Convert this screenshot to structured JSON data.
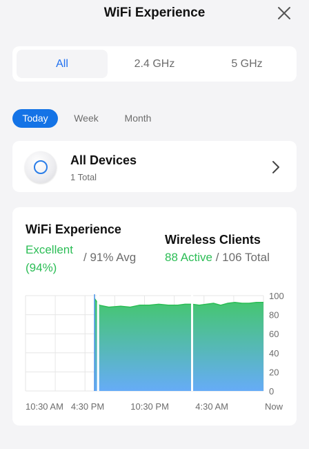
{
  "header": {
    "title": "WiFi Experience",
    "close_icon": "close-icon"
  },
  "bands": {
    "tabs": [
      {
        "label": "All",
        "active": true
      },
      {
        "label": "2.4 GHz",
        "active": false
      },
      {
        "label": "5 GHz",
        "active": false
      }
    ]
  },
  "range": {
    "tabs": [
      {
        "label": "Today",
        "active": true
      },
      {
        "label": "Week",
        "active": false
      },
      {
        "label": "Month",
        "active": false
      }
    ]
  },
  "device": {
    "title": "All Devices",
    "subtitle": "1 Total",
    "icon": "access-point-icon"
  },
  "summary": {
    "experience_title": "WiFi Experience",
    "experience_value": "Excellent (94%)",
    "experience_avg": "/ 91% Avg",
    "clients_title": "Wireless Clients",
    "clients_active": "88 Active",
    "clients_total": "/ 106 Total"
  },
  "colors": {
    "accent": "#1473e6",
    "good": "#2bbd55",
    "fill_top": "#44c76c",
    "fill_bottom": "#66acf7"
  },
  "chart_data": {
    "type": "area",
    "x_ticks": [
      "10:30 AM",
      "4:30 PM",
      "10:30 PM",
      "4:30 AM",
      "Now"
    ],
    "y_ticks": [
      "100",
      "80",
      "60",
      "40",
      "20",
      "0"
    ],
    "ylim": [
      0,
      100
    ],
    "series": [
      {
        "values": [
          [
            0.29,
            97
          ],
          [
            0.31,
            90
          ],
          [
            0.35,
            88
          ],
          [
            0.4,
            89
          ],
          [
            0.44,
            88
          ],
          [
            0.48,
            90
          ],
          [
            0.52,
            90
          ],
          [
            0.56,
            91
          ],
          [
            0.6,
            90
          ],
          [
            0.64,
            90
          ],
          [
            0.67,
            91
          ],
          [
            0.7,
            91
          ],
          [
            0.73,
            90
          ],
          [
            0.76,
            91
          ],
          [
            0.79,
            92
          ],
          [
            0.82,
            90
          ],
          [
            0.85,
            92
          ],
          [
            0.88,
            93
          ],
          [
            0.91,
            92
          ],
          [
            0.94,
            92
          ],
          [
            0.97,
            93
          ],
          [
            1.0,
            93
          ]
        ]
      }
    ],
    "grid": true
  }
}
